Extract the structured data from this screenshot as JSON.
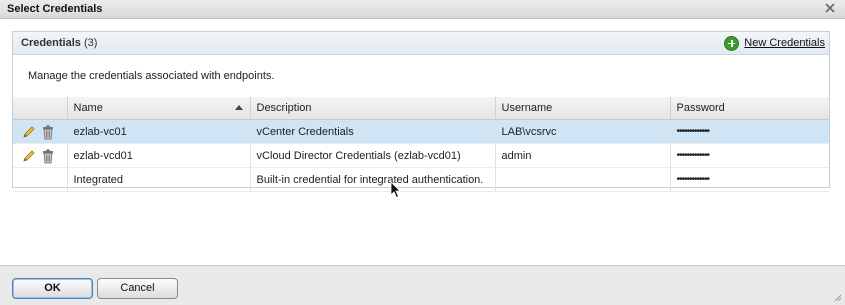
{
  "dialog": {
    "title": "Select Credentials"
  },
  "panel": {
    "title": "Credentials",
    "count": "(3)",
    "new_button": "New Credentials",
    "description": "Manage the credentials associated with endpoints."
  },
  "table": {
    "columns": [
      "Name",
      "Description",
      "Username",
      "Password"
    ],
    "rows": [
      {
        "name": "ezlab-vc01",
        "description": "vCenter Credentials",
        "username": "LAB\\vcsrvc",
        "password": "•••••••••••••",
        "editable": true
      },
      {
        "name": "ezlab-vcd01",
        "description": "vCloud Director Credentials (ezlab-vcd01)",
        "username": "admin",
        "password": "•••••••••••••",
        "editable": true
      },
      {
        "name": "Integrated",
        "description": "Built-in credential for integrated authentication.",
        "username": "",
        "password": "•••••••••••••",
        "editable": false
      }
    ]
  },
  "footer": {
    "ok_label": "OK",
    "cancel_label": "Cancel"
  },
  "colors": {
    "selected_row": "#cfe4f4",
    "accent_green": "#3e9a2a"
  }
}
